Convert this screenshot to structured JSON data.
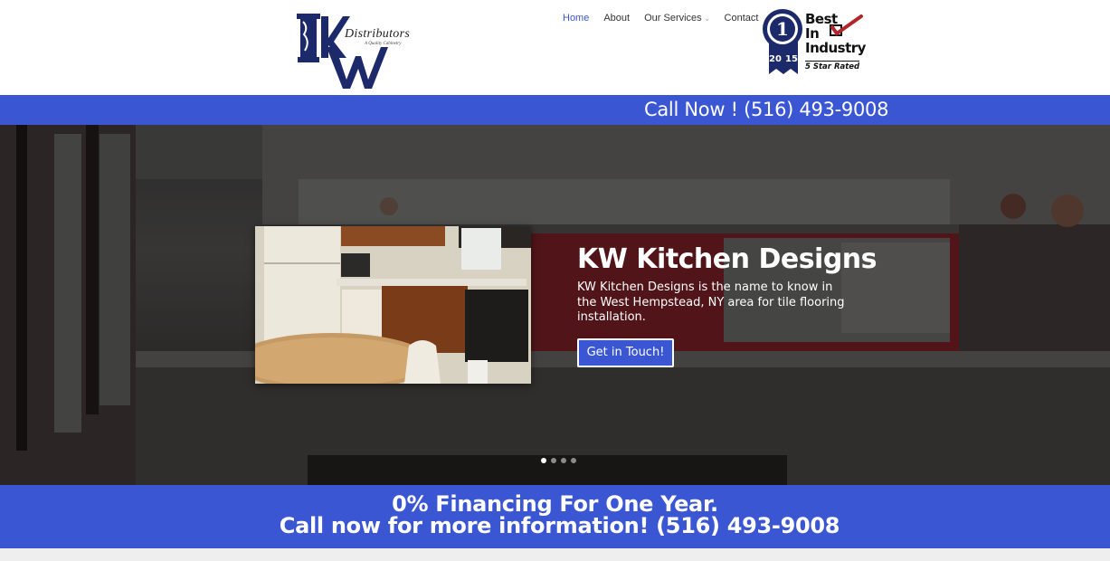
{
  "logo": {
    "initials": "KW",
    "name": "Distributors",
    "tagline": "A Quality Cabinetry"
  },
  "nav": {
    "items": [
      {
        "label": "Home",
        "active": true,
        "has_dropdown": false
      },
      {
        "label": "About",
        "active": false,
        "has_dropdown": false
      },
      {
        "label": "Our Services",
        "active": false,
        "has_dropdown": true
      },
      {
        "label": "Contact",
        "active": false,
        "has_dropdown": false
      }
    ]
  },
  "badge": {
    "rank": "1",
    "year_left": "20",
    "year_right": "15",
    "line1": "Best",
    "line2": "In",
    "line3": "Industry",
    "rating": "5 Star Rated"
  },
  "callbar": {
    "text": "Call Now ! (516) 493-9008"
  },
  "slider": {
    "title": "KW Kitchen Designs",
    "description": "KW Kitchen Designs is the name to know in the West Hempstead, NY area for tile flooring installation.",
    "button_label": "Get in Touch!",
    "slide_count": 4,
    "active_slide": 1
  },
  "financing": {
    "line1": "0% Financing For One Year.",
    "line2": "Call now for more information! (516) 493-9008"
  },
  "colors": {
    "brand_blue": "#3a56d2",
    "nav_active": "#3b56d3",
    "logo_navy": "#1c2a6b"
  }
}
